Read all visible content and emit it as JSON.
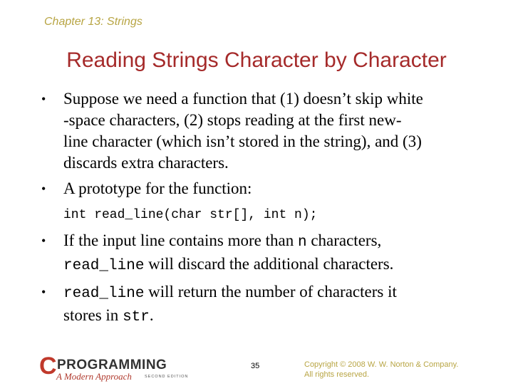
{
  "header": {
    "chapter": "Chapter 13: Strings",
    "title": "Reading Strings Character by Character"
  },
  "bullets": [
    {
      "lines": [
        "Suppose we need a function that (1) doesn’t skip white",
        "-space characters, (2) stops reading at the first new-",
        "line character (which isn’t stored in the string), and (3)",
        "discards extra characters."
      ]
    },
    {
      "text": "A prototype for the function:",
      "code": "int read_line(char str[], int n);"
    },
    {
      "line1_prefix": "If the input line contains more than ",
      "line1_code": "n",
      "line1_suffix": " characters,",
      "line2_code": "read_line",
      "line2_suffix": " will discard the additional characters."
    },
    {
      "line1_code": "read_line",
      "line1_suffix": " will return the number of characters it",
      "line2_prefix": "stores in ",
      "line2_code": "str",
      "line2_suffix": "."
    }
  ],
  "bullet_glyph": "•",
  "footer": {
    "logo": {
      "c": "C",
      "programming": "PROGRAMMING",
      "subtitle": "A Modern Approach",
      "edition": "SECOND EDITION"
    },
    "page_number": "35",
    "copyright_line1": "Copyright © 2008 W. W. Norton & Company.",
    "copyright_line2": "All rights reserved."
  }
}
